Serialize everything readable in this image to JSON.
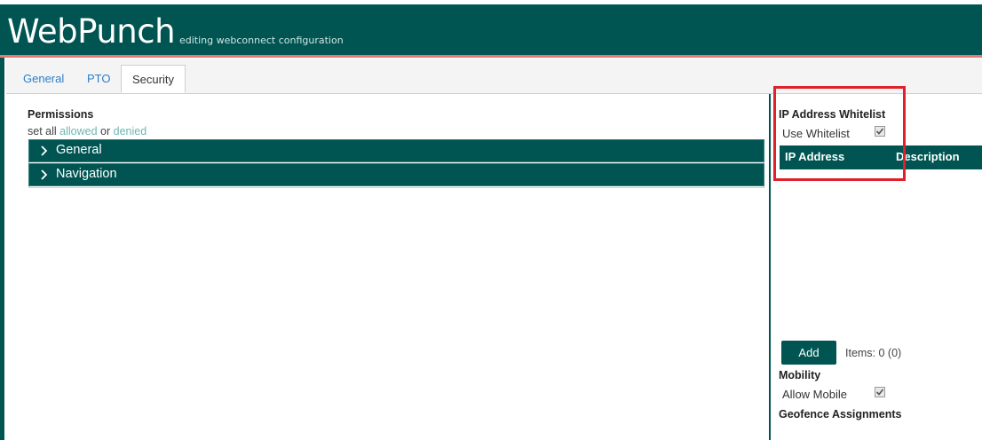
{
  "header": {
    "app_title": "WebPunch",
    "subtitle": "editing webconnect configuration"
  },
  "tabs": [
    {
      "label": "General",
      "active": false
    },
    {
      "label": "PTO",
      "active": false
    },
    {
      "label": "Security",
      "active": true
    }
  ],
  "permissions": {
    "title": "Permissions",
    "set_all_prefix": "set all",
    "allowed_link": "allowed",
    "or_text": "or",
    "denied_link": "denied",
    "panels": [
      {
        "label": "General",
        "icon": "chevron-right-icon"
      },
      {
        "label": "Navigation",
        "icon": "chevron-right-icon"
      }
    ]
  },
  "whitelist": {
    "title": "IP Address Whitelist",
    "use_label": "Use Whitelist",
    "use_checked": true,
    "columns": [
      "IP Address",
      "Description"
    ],
    "add_label": "Add",
    "items_text": "Items: 0 (0)"
  },
  "mobility": {
    "title": "Mobility",
    "allow_label": "Allow Mobile",
    "allow_checked": true
  },
  "geofence": {
    "title": "Geofence Assignments"
  },
  "colors": {
    "brand": "#005552",
    "accent_line": "#e57a73",
    "link": "#2e7ec8",
    "link_light": "#6fb6b2",
    "highlight_box": "#e0202a"
  }
}
